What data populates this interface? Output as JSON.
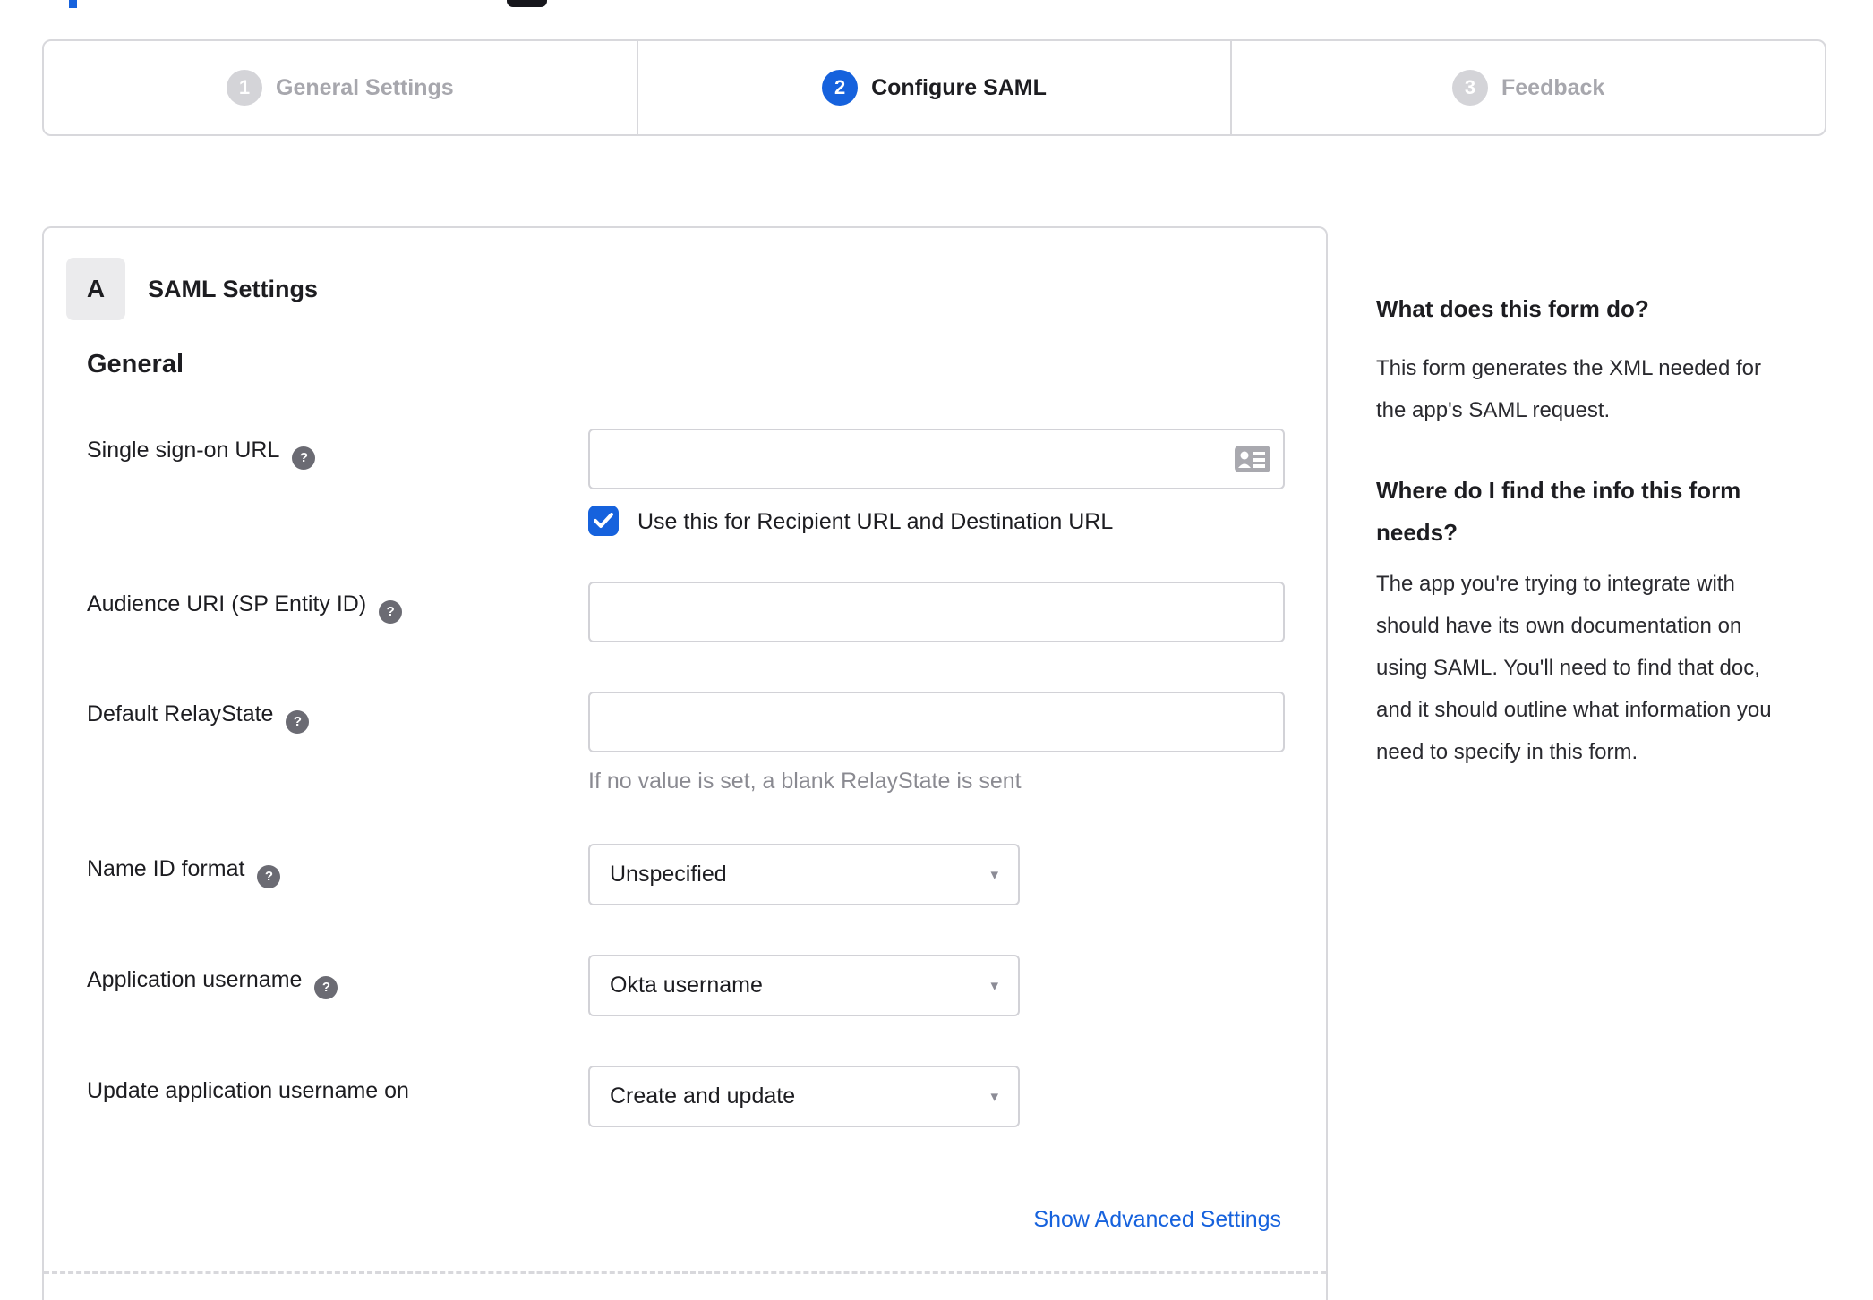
{
  "stepper": {
    "active_step": "2",
    "steps": [
      {
        "number": "1",
        "label": "General Settings"
      },
      {
        "number": "2",
        "label": "Configure SAML"
      },
      {
        "number": "3",
        "label": "Feedback"
      }
    ]
  },
  "panel": {
    "badge": "A",
    "title": "SAML Settings",
    "section_title": "General",
    "fields": {
      "sso": {
        "label": "Single sign-on URL",
        "value": ""
      },
      "sso_checkbox_label": "Use this for Recipient URL and Destination URL",
      "audience": {
        "label": "Audience URI (SP Entity ID)",
        "value": ""
      },
      "relay": {
        "label": "Default RelayState",
        "value": "",
        "helper": "If no value is set, a blank RelayState is sent"
      },
      "name_id": {
        "label": "Name ID format",
        "value": "Unspecified"
      },
      "app_username": {
        "label": "Application username",
        "value": "Okta username"
      },
      "update_username": {
        "label": "Update application username on",
        "value": "Create and update"
      }
    },
    "advanced_link": "Show Advanced Settings"
  },
  "sidebar": {
    "heading_1": "What does this form do?",
    "para_1": "This form generates the XML needed for the app's SAML request.",
    "heading_2": "Where do I find the info this form needs?",
    "para_2": "The app you're trying to integrate with should have its own documentation on using SAML. You'll need to find that doc, and it should outline what information you need to specify in this form."
  },
  "icons": {
    "help_glyph": "?",
    "dropdown_glyph": "▾"
  },
  "colors": {
    "accent_blue": "#1662dd",
    "border_gray": "#d8d8dc",
    "inactive_gray": "#a7a7ad",
    "text_dark": "#1d1d21",
    "helper_gray": "#8a8a91"
  }
}
